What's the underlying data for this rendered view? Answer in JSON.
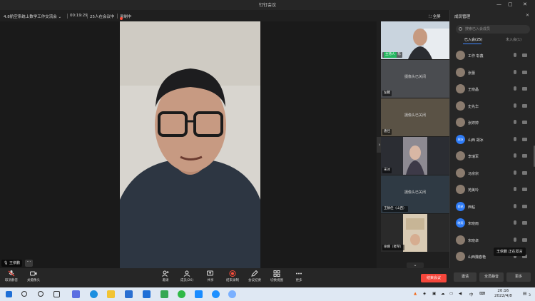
{
  "app": {
    "title": "钉钉会议",
    "window_controls": [
      "—",
      "▢",
      "✕"
    ]
  },
  "meeting": {
    "name": "4.8航空系统上数学工作交流会",
    "duration": "00:19:29",
    "participants_in_meeting": "25人在会议中",
    "recording": "录制中",
    "fullscreen_label": "全屏"
  },
  "speaker": {
    "name": "王依鹏",
    "more_label": "···"
  },
  "thumbnails": [
    {
      "name": "陈",
      "host_badge": "主持人",
      "camera_off": "",
      "kind": "video"
    },
    {
      "name": "左騰",
      "host_badge": "",
      "camera_off": "摄像头已关闭",
      "kind": "off"
    },
    {
      "name": "唐佳",
      "host_badge": "",
      "camera_off": "摄像头已关闭",
      "kind": "off"
    },
    {
      "name": "宋冰",
      "host_badge": "",
      "camera_off": "",
      "kind": "video"
    },
    {
      "name": "王静佳（山西）",
      "host_badge": "",
      "camera_off": "摄像头已关闭",
      "kind": "off"
    },
    {
      "name": "徐娜（者琴）",
      "host_badge": "",
      "camera_off": "",
      "kind": "video"
    }
  ],
  "panel": {
    "title": "成员管理",
    "close": "✕",
    "search_placeholder": "搜索已入会成员",
    "tab_joined": "已入会(25)",
    "tab_not_joined": "未入会(1)",
    "members": [
      {
        "name": "工作 彰鑫",
        "avatar": "",
        "style": "photo"
      },
      {
        "name": "张蕾",
        "avatar": "",
        "style": "photo"
      },
      {
        "name": "王晓晶",
        "avatar": "",
        "style": "photo"
      },
      {
        "name": "史先华",
        "avatar": "",
        "style": "photo"
      },
      {
        "name": "张婷婷",
        "avatar": "",
        "style": "photo"
      },
      {
        "name": "山西 胡冰",
        "avatar": "胡冰",
        "style": "blue"
      },
      {
        "name": "李瑞军",
        "avatar": "",
        "style": "photo"
      },
      {
        "name": "马宗宗",
        "avatar": "",
        "style": "photo"
      },
      {
        "name": "苑美玲",
        "avatar": "",
        "style": "photo"
      },
      {
        "name": "西粘",
        "avatar": "西粘",
        "style": "blue"
      },
      {
        "name": "宋晓雨",
        "avatar": "晓雨",
        "style": "blue"
      },
      {
        "name": "宋晓卓",
        "avatar": "",
        "style": "photo"
      },
      {
        "name": "山西魏春艳",
        "avatar": "",
        "style": "photo"
      }
    ],
    "speaking_tip": "王依鹏  正在发言"
  },
  "toolbar": {
    "mute": "取消静音",
    "camera": "关摄像头",
    "invite": "邀请",
    "members": "成员(26)",
    "share": "共享",
    "record": "结束录制",
    "minutes": "会议纪要",
    "switch_view": "切换视图",
    "more": "更多",
    "leave": "结束会议",
    "panel_invite": "邀请",
    "mute_all": "全员静音",
    "panel_more": "更多"
  },
  "taskbar": {
    "time": "20:16",
    "date": "2022/4/8",
    "ime": "中",
    "notif_count": "3"
  },
  "colors": {
    "accent_blue": "#3f87ff",
    "record_red": "#ff4d3a",
    "host_green": "#25b660",
    "leave_red": "#f5463b"
  }
}
